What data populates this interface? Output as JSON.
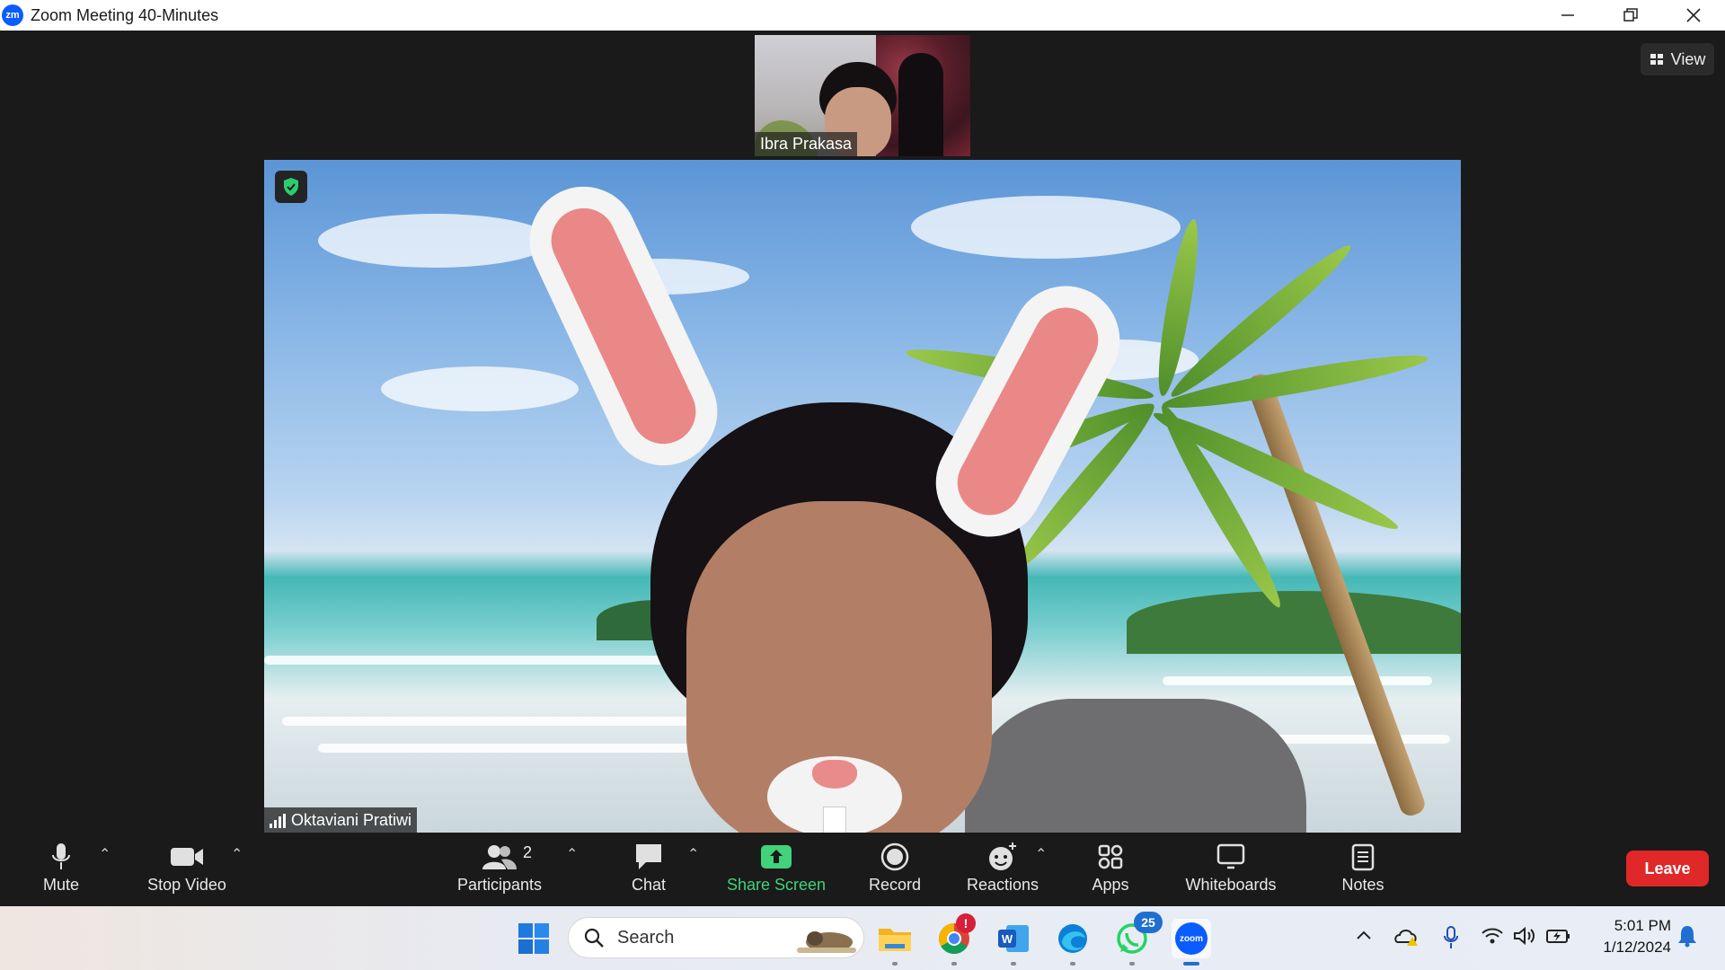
{
  "window": {
    "app_icon_text": "zm",
    "title": "Zoom Meeting 40-Minutes"
  },
  "view_button": {
    "label": "View"
  },
  "thumbnail": {
    "name": "Ibra Prakasa"
  },
  "main_video": {
    "name": "Oktaviani Pratiwi"
  },
  "toolbar": {
    "mute": "Mute",
    "stop_video": "Stop Video",
    "participants": "Participants",
    "participants_count": "2",
    "chat": "Chat",
    "share_screen": "Share Screen",
    "record": "Record",
    "reactions": "Reactions",
    "apps": "Apps",
    "whiteboards": "Whiteboards",
    "notes": "Notes",
    "leave": "Leave"
  },
  "taskbar": {
    "search_label": "Search",
    "chrome_badge": "!",
    "whatsapp_badge": "25",
    "zoom_label": "zoom",
    "time": "5:01 PM",
    "date": "1/12/2024"
  },
  "colors": {
    "accent": "#0b5cff",
    "leave": "#e02828",
    "share": "#41d27b"
  }
}
